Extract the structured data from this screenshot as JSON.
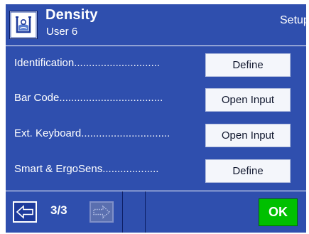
{
  "header": {
    "app_icon": "density-beaker-icon",
    "title": "Density",
    "user": "User 6",
    "setup": "Setup"
  },
  "rows": [
    {
      "label": "Identification.............................",
      "button": "Define"
    },
    {
      "label": "Bar Code...................................",
      "button": "Open Input"
    },
    {
      "label": "Ext. Keyboard..............................",
      "button": "Open Input"
    },
    {
      "label": "Smart & ErgoSens...................",
      "button": "Define"
    }
  ],
  "footer": {
    "back_icon": "arrow-left-icon",
    "page": "3/3",
    "forward_icon": "arrow-right-icon",
    "ok": "OK"
  },
  "colors": {
    "panel": "#2f4fae",
    "ok": "#00c000",
    "button": "#f4f6fb"
  }
}
